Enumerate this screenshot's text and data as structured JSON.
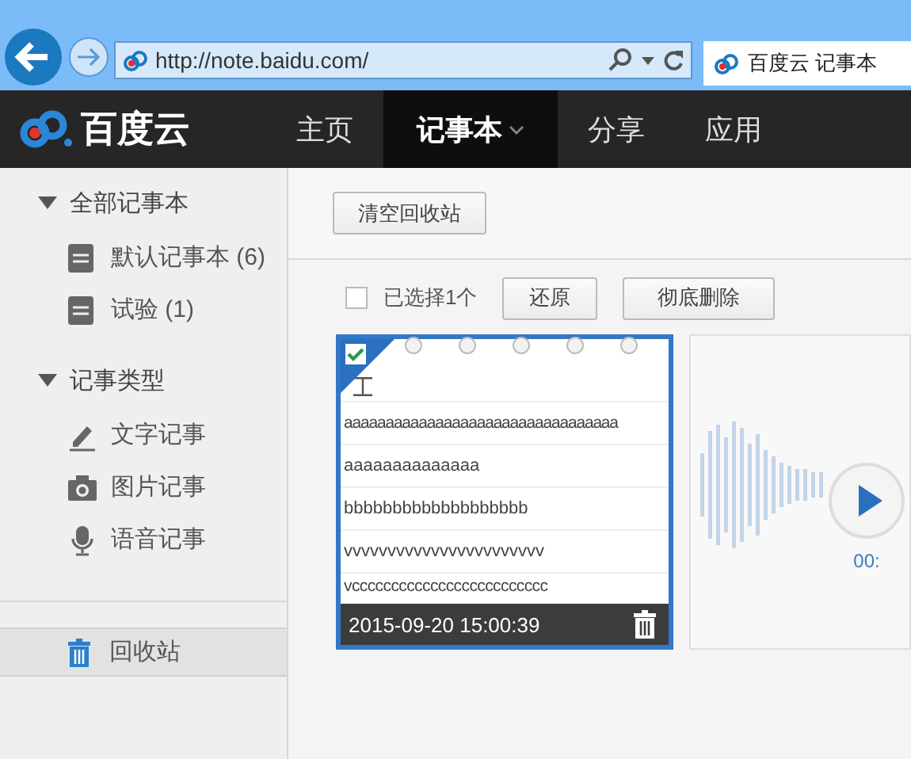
{
  "browser": {
    "address": "http://note.baidu.com/",
    "tab_title": "百度云 记事本"
  },
  "nav": {
    "logo": "百度云",
    "items": [
      {
        "label": "主页",
        "selected": false,
        "dropdown": false
      },
      {
        "label": "记事本",
        "selected": true,
        "dropdown": true
      },
      {
        "label": "分享",
        "selected": false,
        "dropdown": false
      },
      {
        "label": "应用",
        "selected": false,
        "dropdown": false
      }
    ]
  },
  "sidebar": {
    "groups": [
      {
        "label": "全部记事本",
        "expanded": true,
        "children": [
          {
            "label": "默认记事本 (6)",
            "kind": "notebook"
          },
          {
            "label": "试验 (1)",
            "kind": "notebook"
          }
        ]
      },
      {
        "label": "记事类型",
        "expanded": true,
        "children": [
          {
            "label": "文字记事",
            "kind": "text"
          },
          {
            "label": "图片记事",
            "kind": "photo"
          },
          {
            "label": "语音记事",
            "kind": "voice"
          }
        ]
      }
    ],
    "trash": {
      "label": "回收站",
      "selected": true
    }
  },
  "toolbar": {
    "empty_button": "清空回收站"
  },
  "selection": {
    "checked": false,
    "label": "已选择1个",
    "buttons": [
      "还原",
      "彻底删除"
    ]
  },
  "notes": [
    {
      "kind": "text",
      "checked": true,
      "lines": [
        "aaaaaaaaaaaaaaaaaaaaaaaaaaaaaaaaa",
        "aaaaaaaaaaaaaa",
        "bbbbbbbbbbbbbbbbbbb",
        "vvvvvvvvvvvvvvvvvvvvvvv",
        "vccccccccccccccccccccccccc"
      ],
      "date": "2015-09-20 15:00:39"
    },
    {
      "kind": "voice",
      "duration": "00:"
    }
  ]
}
